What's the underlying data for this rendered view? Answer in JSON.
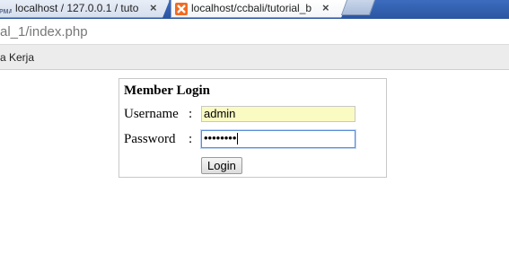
{
  "browser": {
    "tabs": [
      {
        "favicon": "pma-icon",
        "title": "localhost / 127.0.0.1 / tuto"
      },
      {
        "favicon": "xampp-icon",
        "title": "localhost/ccbali/tutorial_b"
      }
    ],
    "close_glyph": "×",
    "address": "al_1/index.php",
    "bookmark": "a Kerja"
  },
  "login": {
    "title": "Member Login",
    "username_label": "Username",
    "password_label": "Password",
    "colon": ":",
    "username_value": "admin",
    "password_value": "••••••••",
    "button_label": "Login"
  },
  "colors": {
    "tabstrip": "#2b5aa6",
    "username_bg": "#fafac3",
    "focus_border": "#5b8bd6"
  }
}
